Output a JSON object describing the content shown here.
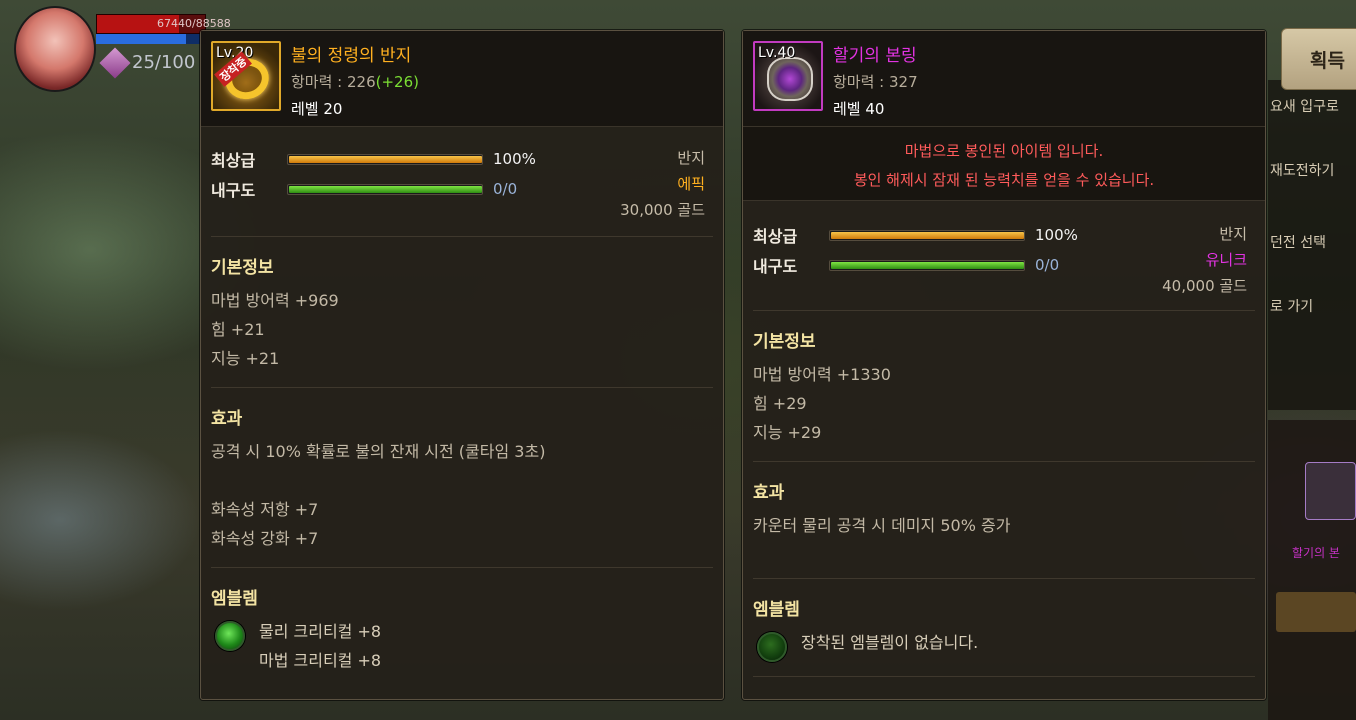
{
  "hud": {
    "hp_text": "67440/88588",
    "fatigue_text": "25/100"
  },
  "get_button": {
    "label": "획득"
  },
  "left_item": {
    "level_tag": "Lv.20",
    "seal_tag": "장착중",
    "name": "불의 정령의 반지",
    "stat_label": "항마력 : 226",
    "stat_bonus": "(+26)",
    "level_line": "레벨 20",
    "grade_label": "최상급",
    "grade_value": "100%",
    "grade_fill": 1.0,
    "durability_label": "내구도",
    "durability_value": "0/0",
    "durability_fill": 1.0,
    "type": "반지",
    "rarity": "에픽",
    "price": "30,000 골드",
    "basic_title": "기본정보",
    "basic_lines": [
      "마법 방어력 +969",
      "힘 +21",
      "지능 +21"
    ],
    "effect_title": "효과",
    "effect_lines": [
      "공격 시 10% 확률로 불의 잔재 시전 (쿨타임 3초)",
      "",
      "화속성 저항 +7",
      "화속성 강화 +7"
    ],
    "emblem_title": "엠블렘",
    "emblem_lines": [
      "물리 크리티컬 +8",
      "마법 크리티컬 +8"
    ]
  },
  "right_item": {
    "level_tag": "Lv.40",
    "name": "할기의 본링",
    "stat_label": "항마력 : 327",
    "level_line": "레벨 40",
    "sealed_lines": [
      "마법으로 봉인된 아이템 입니다.",
      "봉인 해제시 잠재 된 능력치를 얻을 수 있습니다."
    ],
    "grade_label": "최상급",
    "grade_value": "100%",
    "grade_fill": 1.0,
    "durability_label": "내구도",
    "durability_value": "0/0",
    "durability_fill": 1.0,
    "type": "반지",
    "rarity": "유니크",
    "price": "40,000 골드",
    "basic_title": "기본정보",
    "basic_lines": [
      "마법 방어력 +1330",
      "힘 +29",
      "지능 +29"
    ],
    "effect_title": "효과",
    "effect_lines": [
      "카운터 물리 공격 시 데미지 50% 증가"
    ],
    "emblem_title": "엠블렘",
    "emblem_lines": [
      "장착된 엠블렘이 없습니다."
    ]
  },
  "background_menu": [
    "요새 입구로",
    "재도전하기",
    "던전 선택",
    "로 가기"
  ],
  "background_purple_text": "할기의 본",
  "colors": {
    "epic": "#ffb020",
    "unique": "#e233e2",
    "sealed_warning": "#ff5b5b",
    "bonus_green": "#7bde34",
    "section_title": "#f3e3a3"
  }
}
